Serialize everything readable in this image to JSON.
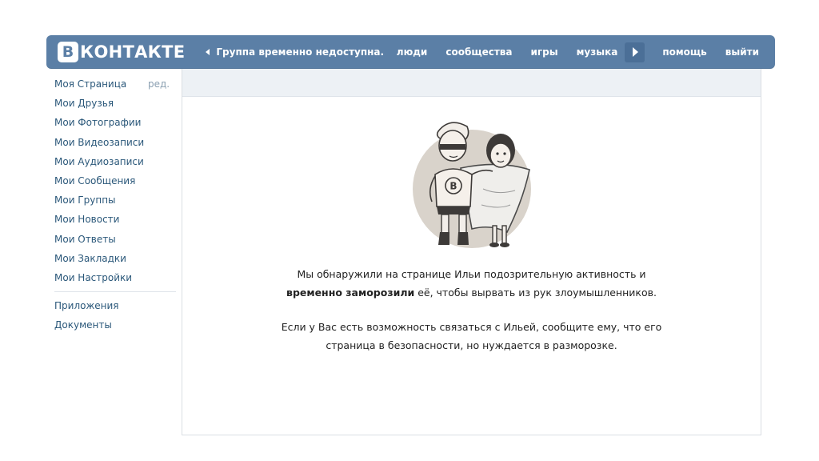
{
  "header": {
    "logo_letter": "В",
    "logo_text": "КОНТАКТЕ",
    "back_link": "Группа временно недоступна.",
    "nav": [
      "люди",
      "сообщества",
      "игры",
      "музыка",
      "помощь",
      "выйти"
    ]
  },
  "sidebar": {
    "items": [
      {
        "label": "Моя Страница"
      },
      {
        "label": "Мои Друзья"
      },
      {
        "label": "Мои Фотографии"
      },
      {
        "label": "Мои Видеозаписи"
      },
      {
        "label": "Мои Аудиозаписи"
      },
      {
        "label": "Мои Сообщения"
      },
      {
        "label": "Мои Группы"
      },
      {
        "label": "Мои Новости"
      },
      {
        "label": "Мои Ответы"
      },
      {
        "label": "Мои Закладки"
      },
      {
        "label": "Мои Настройки"
      }
    ],
    "edit_label": "ред.",
    "extra": [
      {
        "label": "Приложения"
      },
      {
        "label": "Документы"
      }
    ]
  },
  "main": {
    "line1": "Мы обнаружили на странице Ильи подозрительную активность и",
    "line2_bold": "временно заморозили",
    "line2_rest": " её, чтобы вырвать из рук злоумышленников.",
    "line3": "Если у Вас есть возможность связаться с Ильей, сообщите ему, что его",
    "line4": "страница в безопасности, но нуждается в разморозке."
  },
  "colors": {
    "header_bg": "#5b7fa6",
    "link": "#2b587a",
    "panel_strip": "#edf1f5"
  }
}
